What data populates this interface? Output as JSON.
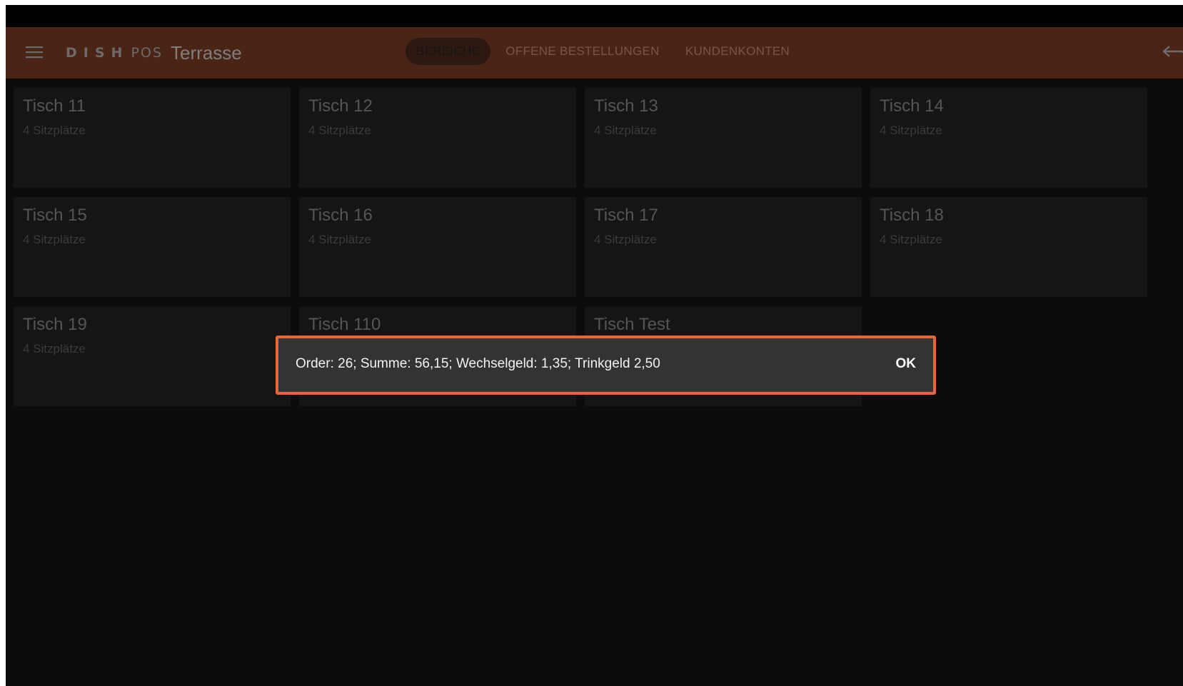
{
  "appbar": {
    "logo_dish": "DISH",
    "logo_pos": "POS",
    "area_title": "Terrasse",
    "tabs": [
      {
        "label": "BEREICHE",
        "active": true
      },
      {
        "label": "OFFENE BESTELLUNGEN",
        "active": false
      },
      {
        "label": "KUNDENKONTEN",
        "active": false
      }
    ],
    "accent_color": "#4a2516"
  },
  "tables": [
    {
      "name": "Tisch 11",
      "seats": "4 Sitzplätze"
    },
    {
      "name": "Tisch 12",
      "seats": "4 Sitzplätze"
    },
    {
      "name": "Tisch 13",
      "seats": "4 Sitzplätze"
    },
    {
      "name": "Tisch 14",
      "seats": "4 Sitzplätze"
    },
    {
      "name": "Tisch 15",
      "seats": "4 Sitzplätze"
    },
    {
      "name": "Tisch 16",
      "seats": "4 Sitzplätze"
    },
    {
      "name": "Tisch 17",
      "seats": "4 Sitzplätze"
    },
    {
      "name": "Tisch 18",
      "seats": "4 Sitzplätze"
    },
    {
      "name": "Tisch 19",
      "seats": "4 Sitzplätze"
    },
    {
      "name": "Tisch 110",
      "seats": ""
    },
    {
      "name": "Tisch Test",
      "seats": ""
    }
  ],
  "dialog": {
    "message": "Order: 26; Summe: 56,15; Wechselgeld: 1,35; Trinkgeld 2,50",
    "ok_label": "OK",
    "highlight_color": "#e8673a"
  },
  "icons": {
    "menu": "hamburger-menu-icon",
    "back": "undo-arrow-icon"
  }
}
